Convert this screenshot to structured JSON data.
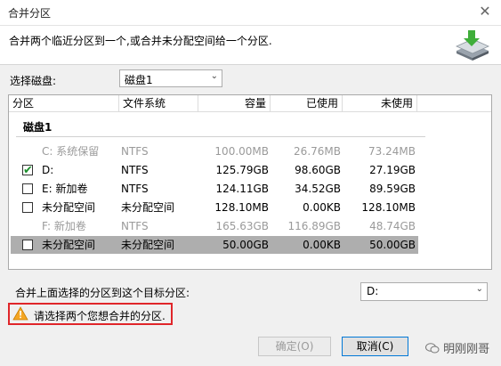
{
  "window": {
    "title": "合并分区",
    "close_icon": "close-icon"
  },
  "header": {
    "description": "合并两个临近分区到一个,或合并未分配空间给一个分区."
  },
  "disk": {
    "label": "选择磁盘:",
    "selected": "磁盘1"
  },
  "table": {
    "columns": [
      "分区",
      "文件系统",
      "容量",
      "已使用",
      "未使用"
    ],
    "group": "磁盘1",
    "rows": [
      {
        "name": "C: 系统保留",
        "fs": "NTFS",
        "capacity": "100.00MB",
        "used": "26.76MB",
        "free": "73.24MB",
        "checkbox": false,
        "checked": false,
        "disabled": true,
        "selected": false
      },
      {
        "name": "D:",
        "fs": "NTFS",
        "capacity": "125.79GB",
        "used": "98.60GB",
        "free": "27.19GB",
        "checkbox": true,
        "checked": true,
        "disabled": false,
        "selected": false
      },
      {
        "name": "E: 新加卷",
        "fs": "NTFS",
        "capacity": "124.11GB",
        "used": "34.52GB",
        "free": "89.59GB",
        "checkbox": true,
        "checked": false,
        "disabled": false,
        "selected": false
      },
      {
        "name": "未分配空间",
        "fs": "未分配空间",
        "capacity": "128.10MB",
        "used": "0.00KB",
        "free": "128.10MB",
        "checkbox": true,
        "checked": false,
        "disabled": false,
        "selected": false
      },
      {
        "name": "F: 新加卷",
        "fs": "NTFS",
        "capacity": "165.63GB",
        "used": "116.89GB",
        "free": "48.74GB",
        "checkbox": false,
        "checked": false,
        "disabled": true,
        "selected": false
      },
      {
        "name": "未分配空间",
        "fs": "未分配空间",
        "capacity": "50.00GB",
        "used": "0.00KB",
        "free": "50.00GB",
        "checkbox": true,
        "checked": false,
        "disabled": false,
        "selected": true
      }
    ]
  },
  "target": {
    "label": "合并上面选择的分区到这个目标分区:",
    "selected": "D:"
  },
  "warning": {
    "text": "请选择两个您想合并的分区."
  },
  "buttons": {
    "ok": "确定(O)",
    "cancel": "取消(C)"
  },
  "watermark": {
    "text": "明刚刚哥"
  },
  "colors": {
    "warning_border": "#e0262a",
    "selected_row": "#aeaeae",
    "check": "#1a8f2a",
    "accent": "#0078d7"
  }
}
